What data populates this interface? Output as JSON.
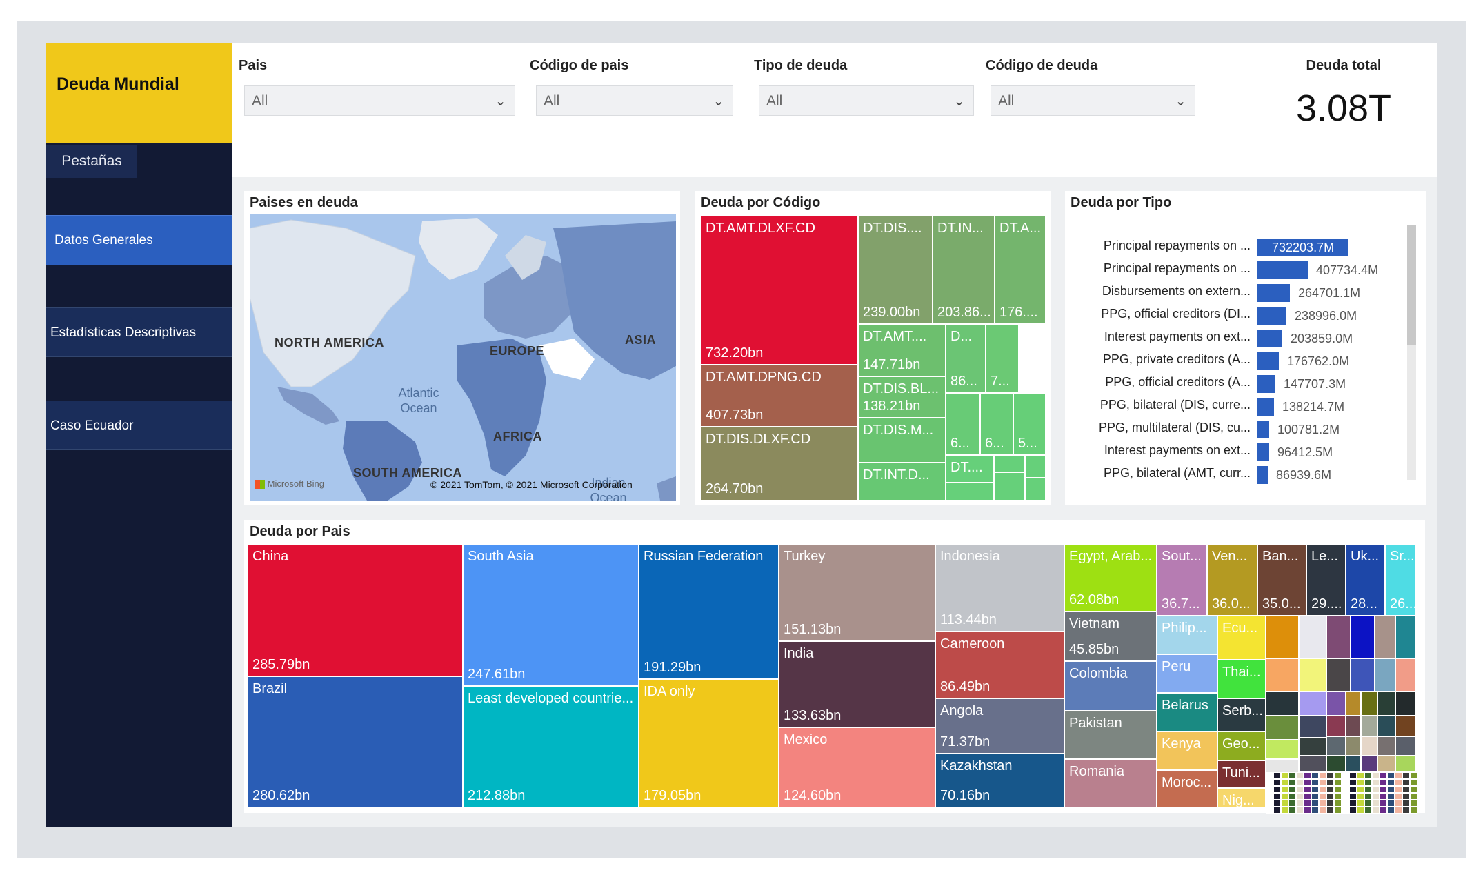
{
  "app": {
    "title": "Deuda Mundial",
    "tabs_label": "Pestañas"
  },
  "nav": [
    {
      "label": "Datos Generales",
      "active": true
    },
    {
      "label": "Estadísticas Descriptivas",
      "active": false
    },
    {
      "label": "Caso Ecuador",
      "active": false
    }
  ],
  "filters": [
    {
      "label": "Pais",
      "value": "All"
    },
    {
      "label": "Código de pais",
      "value": "All"
    },
    {
      "label": "Tipo de deuda",
      "value": "All"
    },
    {
      "label": "Código de deuda",
      "value": "All"
    }
  ],
  "kpi": {
    "label": "Deuda total",
    "value": "3.08T"
  },
  "map": {
    "title": "Paises en deuda",
    "labels": {
      "north_america": "NORTH AMERICA",
      "europe": "EUROPE",
      "asia": "ASIA",
      "africa": "AFRICA",
      "south_america": "SOUTH AMERICA",
      "atlantic": "Atlantic Ocean",
      "indian": "Indian Ocean"
    },
    "attribution": "© 2021 TomTom, © 2021 Microsoft Corporation",
    "logo": "Microsoft Bing"
  },
  "codigo": {
    "title": "Deuda por Código",
    "items": [
      {
        "label": "DT.AMT.DLXF.CD",
        "value": "732.20bn",
        "color": "#e01033"
      },
      {
        "label": "DT.AMT.DPNG.CD",
        "value": "407.73bn",
        "color": "#a4604c"
      },
      {
        "label": "DT.DIS.DLXF.CD",
        "value": "264.70bn",
        "color": "#8b8a5d"
      },
      {
        "label": "DT.DIS....",
        "value": "239.00bn",
        "color": "#82a16b"
      },
      {
        "label": "DT.IN...",
        "value": "203.86...",
        "color": "#7aab6b"
      },
      {
        "label": "DT.A...",
        "value": "176....",
        "color": "#74b56d"
      },
      {
        "label": "DT.AMT....",
        "value": "147.71bn",
        "color": "#6dbf6e"
      },
      {
        "label": "DT.DIS.BL...",
        "value": "138.21bn",
        "color": "#6cc16f"
      },
      {
        "label": "DT.DIS.M...",
        "value": "",
        "color": "#69c470"
      },
      {
        "label": "DT.INT.D...",
        "value": "",
        "color": "#67c873"
      },
      {
        "label": "D...",
        "value": "86...",
        "color": "#6bc574"
      },
      {
        "label": "",
        "value": "7...",
        "color": "#6bc974"
      },
      {
        "label": "",
        "value": "6...",
        "color": "#68cb76"
      },
      {
        "label": "",
        "value": "6...",
        "color": "#67cd77"
      },
      {
        "label": "",
        "value": "5...",
        "color": "#66cf78"
      },
      {
        "label": "DT....",
        "value": "",
        "color": "#66d07a"
      }
    ]
  },
  "tipo": {
    "title": "Deuda por Tipo",
    "max": 732203.7,
    "bars": [
      {
        "label": "Principal repayments on ...",
        "value": 732203.7,
        "display": "732203.7M"
      },
      {
        "label": "Principal repayments on ...",
        "value": 407734.4,
        "display": "407734.4M"
      },
      {
        "label": "Disbursements on extern...",
        "value": 264701.1,
        "display": "264701.1M"
      },
      {
        "label": "PPG, official creditors (DI...",
        "value": 238996.0,
        "display": "238996.0M"
      },
      {
        "label": "Interest payments on ext...",
        "value": 203859.0,
        "display": "203859.0M"
      },
      {
        "label": "PPG, private creditors (A...",
        "value": 176762.0,
        "display": "176762.0M"
      },
      {
        "label": "PPG, official creditors (A...",
        "value": 147707.3,
        "display": "147707.3M"
      },
      {
        "label": "PPG, bilateral (DIS, curre...",
        "value": 138214.7,
        "display": "138214.7M"
      },
      {
        "label": "PPG, multilateral (DIS, cu...",
        "value": 100781.2,
        "display": "100781.2M"
      },
      {
        "label": "Interest payments on ext...",
        "value": 96412.5,
        "display": "96412.5M"
      },
      {
        "label": "PPG, bilateral (AMT, curr...",
        "value": 86939.6,
        "display": "86939.6M"
      }
    ]
  },
  "pais": {
    "title": "Deuda por Pais",
    "items": [
      {
        "label": "China",
        "value": "285.79bn",
        "color": "#e01033"
      },
      {
        "label": "Brazil",
        "value": "280.62bn",
        "color": "#2a5db5"
      },
      {
        "label": "South Asia",
        "value": "247.61bn",
        "color": "#4d94f5"
      },
      {
        "label": "Least developed countrie...",
        "value": "212.88bn",
        "color": "#00b6c3"
      },
      {
        "label": "Russian Federation",
        "value": "191.29bn",
        "color": "#0a66b7"
      },
      {
        "label": "IDA only",
        "value": "179.05bn",
        "color": "#f0c81a"
      },
      {
        "label": "Turkey",
        "value": "151.13bn",
        "color": "#a9918c"
      },
      {
        "label": "India",
        "value": "133.63bn",
        "color": "#553547"
      },
      {
        "label": "Mexico",
        "value": "124.60bn",
        "color": "#f3847f"
      },
      {
        "label": "Indonesia",
        "value": "113.44bn",
        "color": "#c1c4c9"
      },
      {
        "label": "Cameroon",
        "value": "86.49bn",
        "color": "#bd4b49"
      },
      {
        "label": "Angola",
        "value": "71.37bn",
        "color": "#68708b"
      },
      {
        "label": "Kazakhstan",
        "value": "70.16bn",
        "color": "#17578b"
      },
      {
        "label": "Egypt, Arab...",
        "value": "62.08bn",
        "color": "#9ee012"
      },
      {
        "label": "Vietnam",
        "value": "45.85bn",
        "color": "#6c7278"
      },
      {
        "label": "Colombia",
        "value": "",
        "color": "#5c7cb8"
      },
      {
        "label": "Pakistan",
        "value": "",
        "color": "#7d8681"
      },
      {
        "label": "Romania",
        "value": "",
        "color": "#b9808e"
      },
      {
        "label": "Sout...",
        "value": "36.7...",
        "color": "#b67cb2"
      },
      {
        "label": "Ven...",
        "value": "36.0...",
        "color": "#b49a22"
      },
      {
        "label": "Ban...",
        "value": "35.0...",
        "color": "#6d4434"
      },
      {
        "label": "Le...",
        "value": "29....",
        "color": "#2d3641"
      },
      {
        "label": "Uk...",
        "value": "28...",
        "color": "#1d47a8"
      },
      {
        "label": "Sr...",
        "value": "26...",
        "color": "#4fdce4"
      },
      {
        "label": "Philip...",
        "value": "",
        "color": "#a3d6eb"
      },
      {
        "label": "Peru",
        "value": "",
        "color": "#82aaf0"
      },
      {
        "label": "Belarus",
        "value": "",
        "color": "#1a8a82"
      },
      {
        "label": "Kenya",
        "value": "",
        "color": "#f2c45a"
      },
      {
        "label": "Moroc...",
        "value": "",
        "color": "#c46c50"
      },
      {
        "label": "Ecu...",
        "value": "",
        "color": "#f4e431"
      },
      {
        "label": "Thai...",
        "value": "",
        "color": "#41e33d"
      },
      {
        "label": "Serb...",
        "value": "",
        "color": "#2a3a41"
      },
      {
        "label": "Geo...",
        "value": "",
        "color": "#8dac1f"
      },
      {
        "label": "Tuni...",
        "value": "",
        "color": "#7b2f31"
      },
      {
        "label": "Nig...",
        "value": "",
        "color": "#f6d76b"
      }
    ],
    "small_colors": [
      "#dd8f0a",
      "#e8e8ee",
      "#7e4b74",
      "#0c13c4",
      "#a7928a",
      "#1f8692",
      "#f7a662",
      "#f2f47a",
      "#4a4648",
      "#3e55b8",
      "#7aa6c0",
      "#f19c88",
      "#27353a",
      "#a59af0",
      "#7a54a8",
      "#b58a2a",
      "#686f14",
      "#293f36",
      "#232a2c",
      "#6a8e3c",
      "#3e4760",
      "#8a3a52",
      "#6d4a52",
      "#a3a99a",
      "#2a4d58",
      "#714320",
      "#c1e960",
      "#35403e",
      "#5d6870",
      "#8c8a6c",
      "#e5d6c8",
      "#777070",
      "#5a5f6a",
      "#e6e6e6",
      "#51505c",
      "#2c4b30",
      "#2a4f5e",
      "#5a3a7c",
      "#c9b48a",
      "#a8d65c",
      "#e04d6a",
      "#2b2a3a"
    ]
  }
}
